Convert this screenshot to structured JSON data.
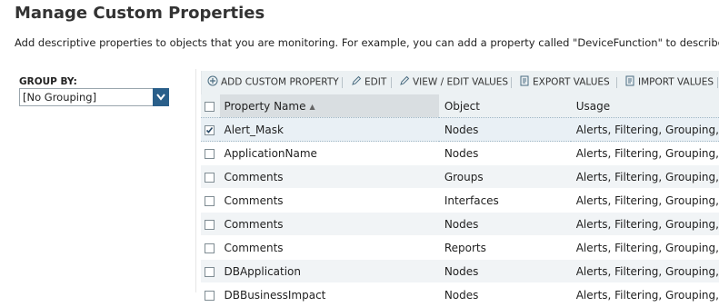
{
  "page": {
    "title": "Manage Custom Properties",
    "description": "Add descriptive properties to objects that you are monitoring. For example, you can add a property called \"DeviceFunction\" to describe how"
  },
  "groupby": {
    "label": "GROUP BY:",
    "selected": "[No Grouping]"
  },
  "toolbar": {
    "add": "ADD CUSTOM PROPERTY",
    "edit": "EDIT",
    "view_edit": "VIEW / EDIT VALUES",
    "export": "EXPORT VALUES",
    "import": "IMPORT VALUES"
  },
  "table": {
    "columns": {
      "name": "Property Name",
      "object": "Object",
      "usage": "Usage"
    },
    "sort_indicator": "▲",
    "rows": [
      {
        "name": "Alert_Mask",
        "object": "Nodes",
        "usage": "Alerts, Filtering, Grouping,",
        "checked": true
      },
      {
        "name": "ApplicationName",
        "object": "Nodes",
        "usage": "Alerts, Filtering, Grouping,",
        "checked": false
      },
      {
        "name": "Comments",
        "object": "Groups",
        "usage": "Alerts, Filtering, Grouping,",
        "checked": false
      },
      {
        "name": "Comments",
        "object": "Interfaces",
        "usage": "Alerts, Filtering, Grouping,",
        "checked": false
      },
      {
        "name": "Comments",
        "object": "Nodes",
        "usage": "Alerts, Filtering, Grouping,",
        "checked": false
      },
      {
        "name": "Comments",
        "object": "Reports",
        "usage": "Alerts, Filtering, Grouping,",
        "checked": false
      },
      {
        "name": "DBApplication",
        "object": "Nodes",
        "usage": "Alerts, Filtering, Grouping,",
        "checked": false
      },
      {
        "name": "DBBusinessImpact",
        "object": "Nodes",
        "usage": "Alerts, Filtering, Grouping,",
        "checked": false
      }
    ]
  },
  "colors": {
    "accent": "#2a5f8a",
    "panel_bg": "#ecf1f3",
    "sorted_header_bg": "#d9dee1"
  },
  "icons": {
    "add": "plus-circle-icon",
    "edit": "pencil-icon",
    "view_edit": "pencil-icon",
    "export": "document-export-icon",
    "import": "document-import-icon",
    "dropdown": "chevron-down-icon"
  }
}
